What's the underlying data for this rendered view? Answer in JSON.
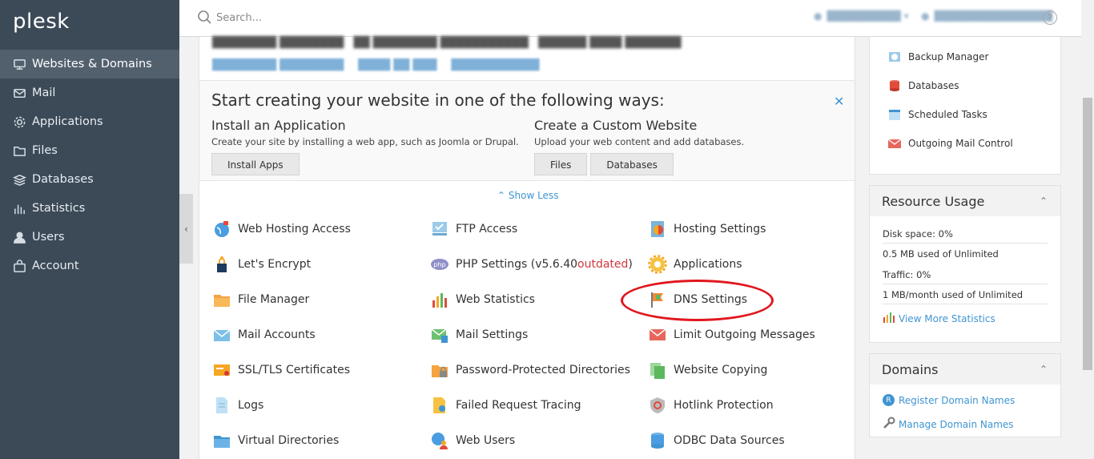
{
  "sidebar": {
    "logo": "plesk",
    "items": [
      {
        "label": "Websites & Domains",
        "icon": "monitor-icon",
        "active": true
      },
      {
        "label": "Mail",
        "icon": "mail-icon"
      },
      {
        "label": "Applications",
        "icon": "gear-icon"
      },
      {
        "label": "Files",
        "icon": "folder-icon"
      },
      {
        "label": "Databases",
        "icon": "database-icon"
      },
      {
        "label": "Statistics",
        "icon": "bar-chart-icon"
      },
      {
        "label": "Users",
        "icon": "user-icon"
      },
      {
        "label": "Account",
        "icon": "account-icon"
      }
    ]
  },
  "topbar": {
    "search_placeholder": "Search..."
  },
  "start": {
    "title": "Start creating your website in one of the following ways:",
    "install": {
      "heading": "Install an Application",
      "desc": "Create your site by installing a web app, such as Joomla or Drupal.",
      "button": "Install Apps"
    },
    "custom": {
      "heading": "Create a Custom Website",
      "desc": "Upload your web content and add databases.",
      "button_files": "Files",
      "button_databases": "Databases"
    },
    "show_less": "Show Less"
  },
  "tools": {
    "col1": [
      "Web Hosting Access",
      "Let's Encrypt",
      "File Manager",
      "Mail Accounts",
      "SSL/TLS Certificates",
      "Logs",
      "Virtual Directories"
    ],
    "col2": [
      "FTP Access",
      "PHP Settings (v5.6.40 ",
      "Web Statistics",
      "Mail Settings",
      "Password-Protected Directories",
      "Failed Request Tracing",
      "Web Users"
    ],
    "php_outdated": "outdated",
    "php_close": ")",
    "col3": [
      "Hosting Settings",
      "Applications",
      "DNS Settings",
      "Limit Outgoing Messages",
      "Website Copying",
      "Hotlink Protection",
      "ODBC Data Sources"
    ]
  },
  "right": {
    "links": [
      "Backup Manager",
      "Databases",
      "Scheduled Tasks",
      "Outgoing Mail Control"
    ],
    "resource_usage": {
      "title": "Resource Usage",
      "disk_label": "Disk space: 0%",
      "disk_detail": "0.5 MB used of Unlimited",
      "traffic_label": "Traffic: 0%",
      "traffic_detail": "1 MB/month used of Unlimited",
      "more_link": "View More Statistics"
    },
    "domains": {
      "title": "Domains",
      "register": "Register Domain Names",
      "manage": "Manage Domain Names"
    }
  },
  "colors": {
    "sidebar_bg": "#3c4a58",
    "link_blue": "#3f95d1",
    "outdated_red": "#d0383c",
    "highlight_ring": "#e1171e"
  }
}
